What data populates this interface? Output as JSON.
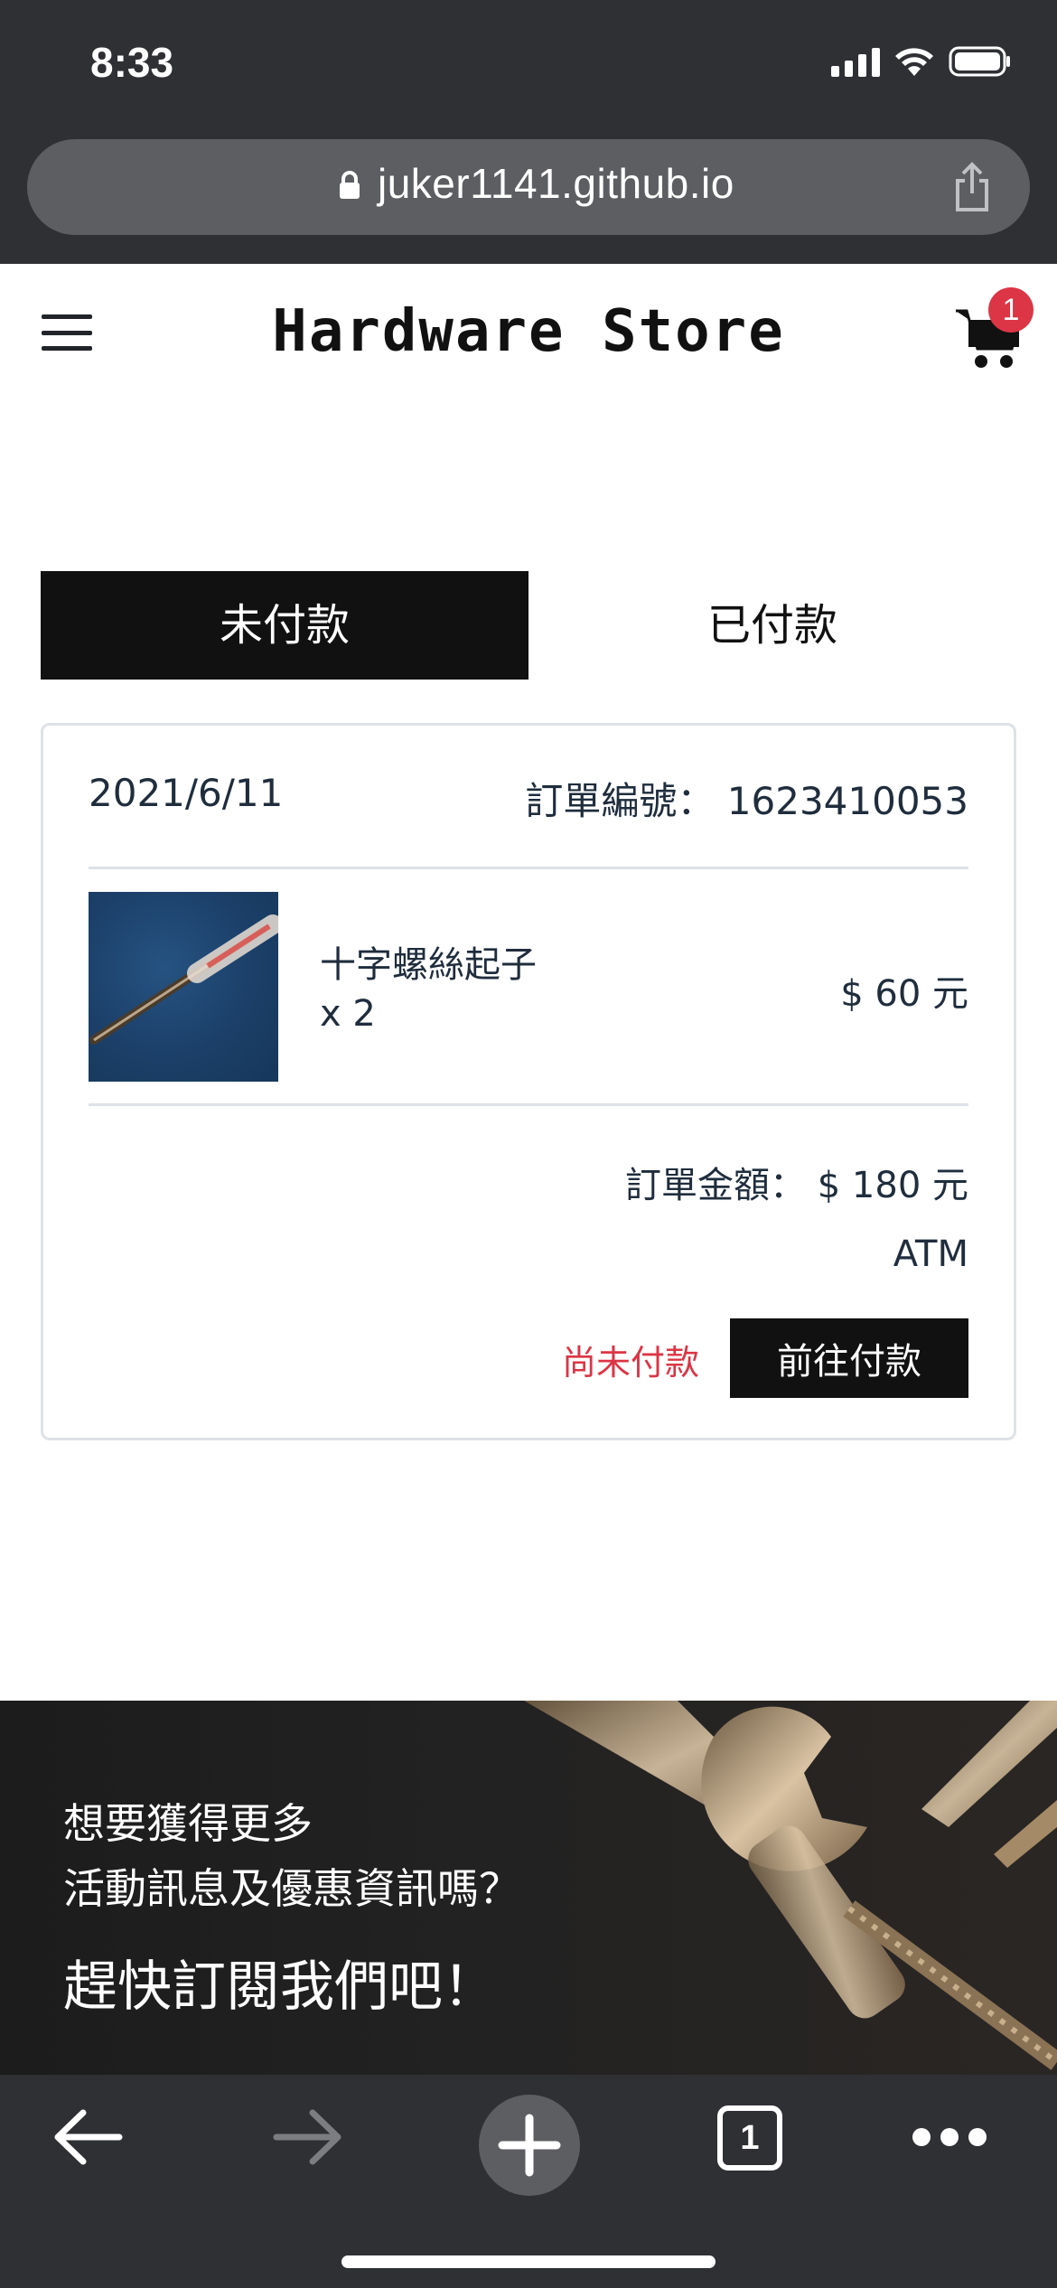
{
  "status_bar": {
    "time": "8:33"
  },
  "browser": {
    "url": "juker1141.github.io",
    "tab_count": "1"
  },
  "navbar": {
    "brand": "Hardware Store",
    "cart_count": "1"
  },
  "tabs": [
    {
      "label": "未付款",
      "active": true
    },
    {
      "label": "已付款",
      "active": false
    }
  ],
  "order": {
    "date": "2021/6/11",
    "order_number": "訂單編號： 1623410053",
    "items": [
      {
        "name": "十字螺絲起子",
        "qty": "x 2",
        "price": "$ 60 元"
      }
    ],
    "total": "訂單金額： $ 180 元",
    "payment_method": "ATM",
    "payment_status": "尚未付款",
    "pay_button": "前往付款"
  },
  "banner": {
    "line1": "想要獲得更多",
    "line2": "活動訊息及優惠資訊嗎？",
    "title": "趕快訂閱我們吧！"
  },
  "colors": {
    "chrome": "#2f3033",
    "accent_dark": "#111111",
    "status_red": "#dc3545"
  }
}
